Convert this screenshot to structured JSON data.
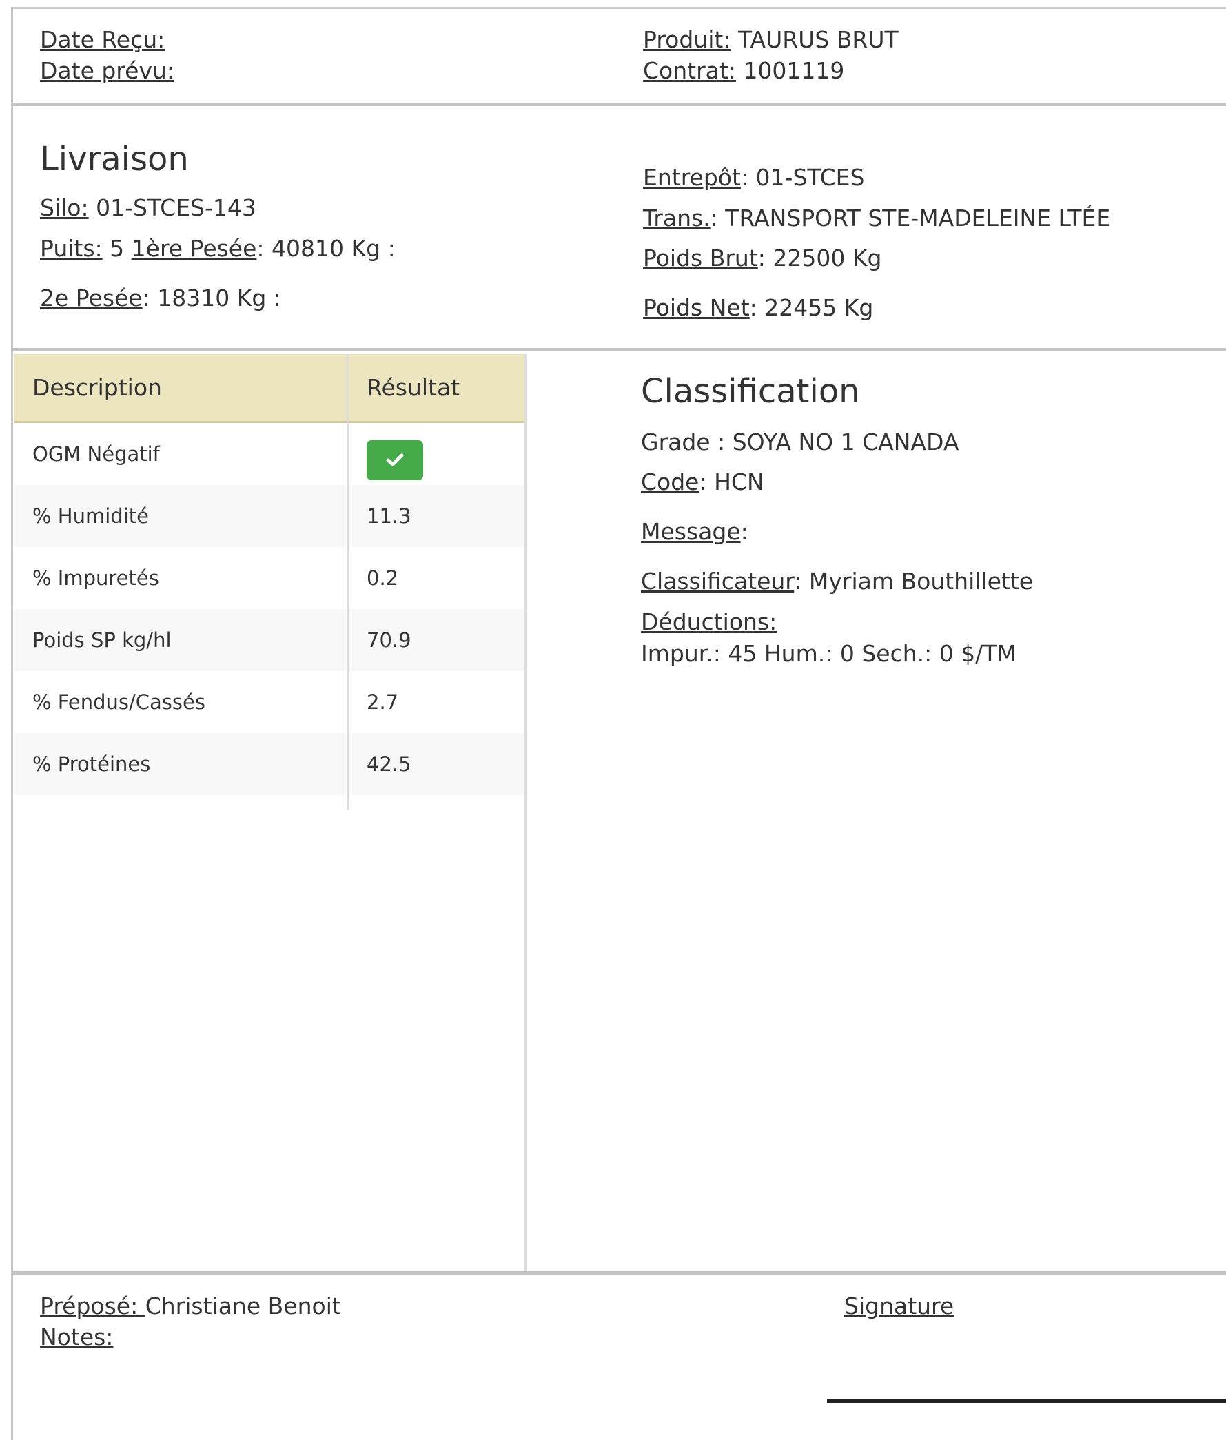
{
  "header": {
    "date_recu_label": "Date Reçu:",
    "date_prevu_label": "Date prévu:",
    "produit_label": "Produit:",
    "produit_value": "TAURUS BRUT",
    "contrat_label": "Contrat:",
    "contrat_value": "1001119"
  },
  "livraison": {
    "title": "Livraison",
    "silo_label": "Silo:",
    "silo_value": "01-STCES-143",
    "puits_label": "Puits:",
    "puits_value": "5",
    "pesee1_label": "1ère Pesée",
    "pesee1_value": ": 40810 Kg :",
    "pesee2_label": "2e Pesée",
    "pesee2_value": ": 18310 Kg :",
    "entrepot_label": "Entrepôt",
    "entrepot_value": ": 01-STCES",
    "trans_label": "Trans.",
    "trans_value": ": TRANSPORT STE-MADELEINE LTÉE",
    "poids_brut_label": "Poids Brut",
    "poids_brut_value": ": 22500 Kg",
    "poids_net_label": "Poids Net",
    "poids_net_value": ": 22455 Kg"
  },
  "table": {
    "col_description": "Description",
    "col_resultat": "Résultat",
    "check_icon": "check-icon",
    "check_color": "#46a94a",
    "header_color": "#ede5bf",
    "rows": [
      {
        "description": "OGM Négatif",
        "resultat": ""
      },
      {
        "description": "% Humidité",
        "resultat": "11.3"
      },
      {
        "description": "% Impuretés",
        "resultat": "0.2"
      },
      {
        "description": "Poids SP kg/hl",
        "resultat": "70.9"
      },
      {
        "description": "% Fendus/Cassés",
        "resultat": "2.7"
      },
      {
        "description": "% Protéines",
        "resultat": "42.5"
      }
    ]
  },
  "classification": {
    "title": "Classification",
    "grade": "Grade : SOYA NO 1 CANADA",
    "code_label": "Code",
    "code_value": ": HCN",
    "message_label": "Message",
    "message_value": ":",
    "classificateur_label": "Classificateur",
    "classificateur_value": ": Myriam Bouthillette",
    "deductions_label": "Déductions:",
    "deductions_value": "Impur.: 45 Hum.: 0 Sech.: 0 $/TM"
  },
  "footer": {
    "prepose_label": "Préposé: ",
    "prepose_value": "Christiane Benoit",
    "notes_label": "Notes:",
    "signature_label": "Signature"
  }
}
